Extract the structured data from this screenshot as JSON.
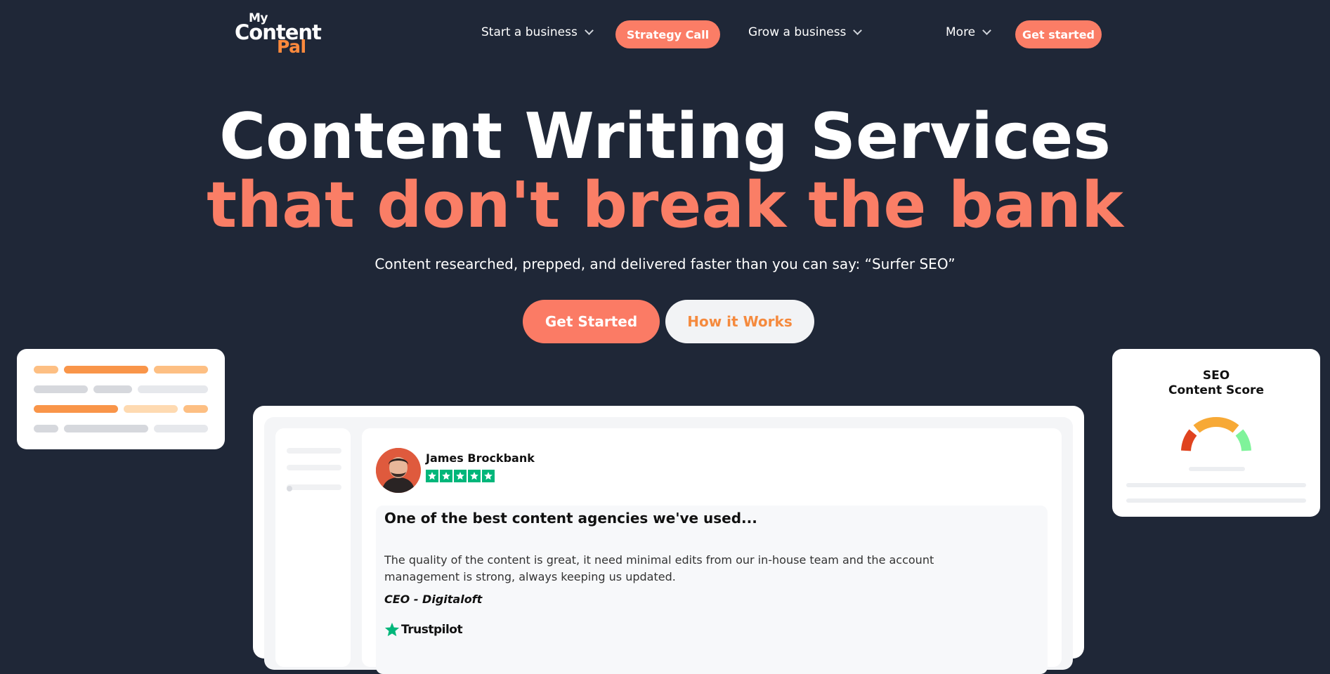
{
  "brand": {
    "logo_line1": "My",
    "logo_line2": "Content",
    "logo_line3": "Pal",
    "accent": "#fb7d66",
    "logo_accent": "#ff8a3d"
  },
  "nav": {
    "start_business": "Start a business",
    "strategy_call": "Strategy Call",
    "grow_business": "Grow a business",
    "more": "More",
    "get_started": "Get started"
  },
  "hero": {
    "title_line1": "Content Writing Services",
    "title_line2": "that don't break the bank",
    "subtitle": "Content researched, prepped, and delivered faster than you can say: “Surfer SEO”",
    "cta_primary": "Get Started",
    "cta_secondary": "How it Works"
  },
  "seo_card": {
    "title_line1": "SEO",
    "title_line2": "Content Score"
  },
  "review": {
    "name": "James Brockbank",
    "rating": 5,
    "title": "One of the best content agencies we've used...",
    "body": "The quality of the content is great, it need minimal edits from our in-house team and the account management is strong, always keeping us updated.",
    "author": "CEO - Digitaloft",
    "source": "Trustpilot",
    "source_color": "#00b67a"
  }
}
